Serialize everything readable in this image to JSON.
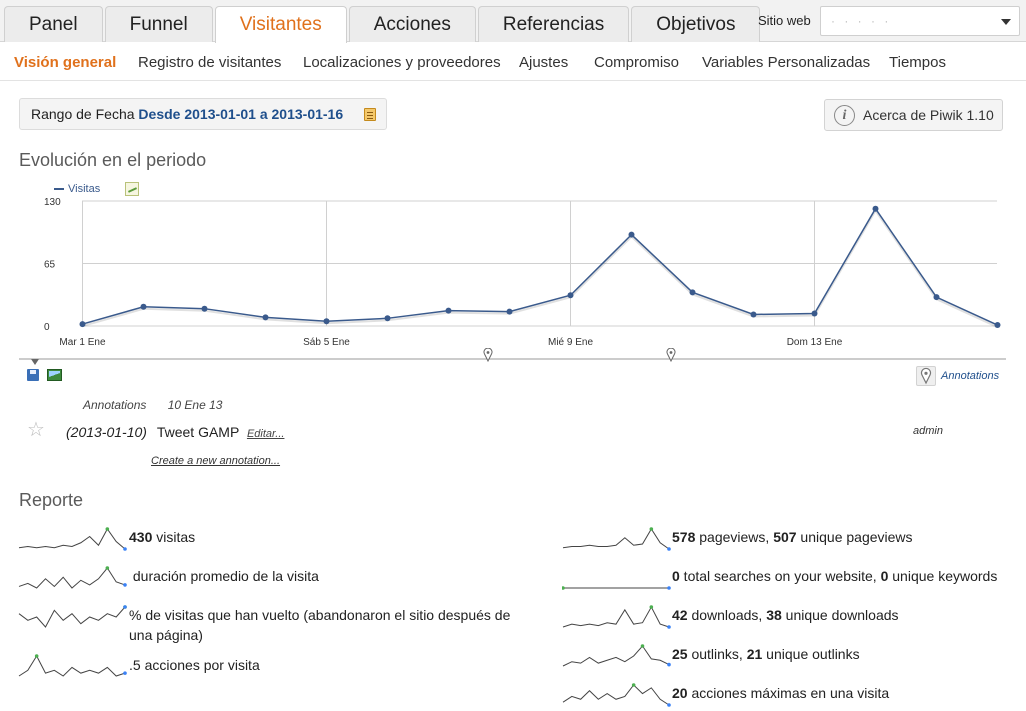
{
  "nav": {
    "tabs": [
      {
        "label": "Panel",
        "active": false
      },
      {
        "label": "Funnel",
        "active": false
      },
      {
        "label": "Visitantes",
        "active": true
      },
      {
        "label": "Acciones",
        "active": false
      },
      {
        "label": "Referencias",
        "active": false
      },
      {
        "label": "Objetivos",
        "active": false
      }
    ],
    "site_label": "Sitio web",
    "site_value": "· ·  ·  ·  ·"
  },
  "subnav": {
    "items": [
      {
        "label": "Visión general",
        "active": true
      },
      {
        "label": "Registro de visitantes",
        "active": false
      },
      {
        "label": "Localizaciones y proveedores",
        "active": false
      },
      {
        "label": "Ajustes",
        "active": false
      },
      {
        "label": "Compromiso",
        "active": false
      },
      {
        "label": "Variables Personalizadas",
        "active": false
      },
      {
        "label": "Tiempos",
        "active": false
      }
    ]
  },
  "date_range": {
    "prefix": "Rango de Fecha",
    "range": "Desde 2013-01-01 a 2013-01-16"
  },
  "about": {
    "label": "Acerca de Piwik 1.10"
  },
  "evolution": {
    "title": "Evolución en el periodo",
    "legend": "Visitas",
    "annotations_link": "Annotations"
  },
  "chart_data": {
    "type": "line",
    "series": [
      {
        "name": "Visitas",
        "values": [
          2,
          20,
          18,
          9,
          5,
          8,
          16,
          15,
          32,
          95,
          35,
          12,
          13,
          122,
          30,
          1
        ]
      }
    ],
    "x": [
      "Mar 1 Ene",
      "",
      "",
      "",
      "Sáb 5 Ene",
      "",
      "",
      "",
      "Mié 9 Ene",
      "",
      "",
      "",
      "Dom 13 Ene",
      "",
      "",
      ""
    ],
    "yticks": [
      "0",
      "65",
      "130"
    ],
    "ylim": [
      0,
      130
    ],
    "grid": true,
    "color": "#3a5a8c"
  },
  "annotations": {
    "header_label": "Annotations",
    "header_date": "10 Ene 13",
    "items": [
      {
        "date": "(2013-01-10)",
        "note": "Tweet GAMP",
        "edit": "Editar...",
        "user": "admin"
      }
    ],
    "create": "Create a new annotation..."
  },
  "report": {
    "title": "Reporte",
    "left": [
      {
        "value": "430",
        "text": " visitas",
        "spark": [
          3,
          4,
          3,
          4,
          3,
          5,
          4,
          7,
          12,
          5,
          18,
          8,
          2
        ]
      },
      {
        "value": "",
        "text": " duración promedio de la visita",
        "spark": [
          4,
          6,
          3,
          9,
          4,
          10,
          3,
          8,
          5,
          9,
          16,
          7,
          5
        ]
      },
      {
        "value": "",
        "text": "% de visitas que han vuelto (abandonaron el sitio después de una página)",
        "spark": [
          8,
          6,
          7,
          4,
          9,
          6,
          8,
          5,
          7,
          6,
          8,
          7,
          10
        ]
      },
      {
        "value": "",
        "text": ".5 acciones por visita",
        "spark": [
          3,
          5,
          10,
          4,
          5,
          3,
          6,
          4,
          5,
          4,
          6,
          3,
          4
        ]
      }
    ],
    "right": [
      {
        "value": "578",
        "text": " pageviews, ",
        "value2": "507",
        "text2": " unique pageviews",
        "spark": [
          2,
          3,
          3,
          4,
          3,
          3,
          4,
          10,
          4,
          5,
          17,
          6,
          1
        ]
      },
      {
        "value": "0",
        "text": " total searches on your website, ",
        "value2": "0",
        "text2": " unique keywords",
        "spark": [
          0,
          0,
          0,
          0,
          0,
          0,
          0,
          0,
          0,
          0,
          0,
          0,
          0
        ]
      },
      {
        "value": "42",
        "text": " downloads, ",
        "value2": "38",
        "text2": " unique downloads",
        "spark": [
          2,
          4,
          3,
          4,
          3,
          5,
          4,
          14,
          4,
          5,
          16,
          4,
          2
        ]
      },
      {
        "value": "25",
        "text": " outlinks, ",
        "value2": "21",
        "text2": " unique outlinks",
        "spark": [
          2,
          5,
          4,
          8,
          4,
          6,
          8,
          5,
          9,
          16,
          7,
          6,
          3
        ]
      },
      {
        "value": "20",
        "text": " acciones máximas en una visita",
        "spark": [
          2,
          4,
          3,
          6,
          3,
          5,
          3,
          4,
          8,
          5,
          7,
          3,
          1
        ]
      }
    ]
  }
}
